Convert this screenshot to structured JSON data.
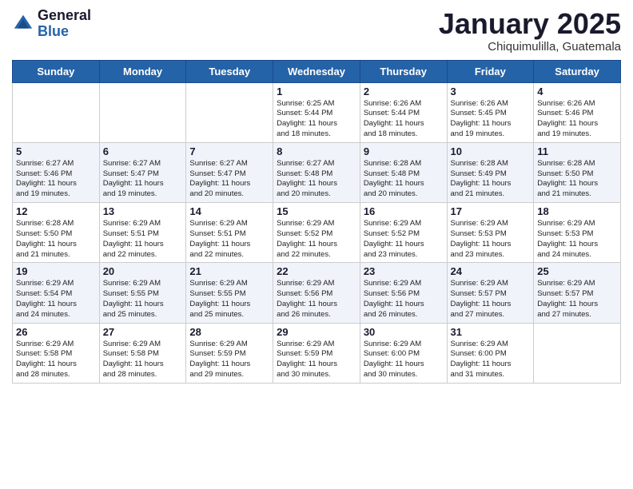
{
  "header": {
    "logo_general": "General",
    "logo_blue": "Blue",
    "title": "January 2025",
    "location": "Chiquimulilla, Guatemala"
  },
  "weekdays": [
    "Sunday",
    "Monday",
    "Tuesday",
    "Wednesday",
    "Thursday",
    "Friday",
    "Saturday"
  ],
  "weeks": [
    {
      "alt": false,
      "days": [
        {
          "num": "",
          "info": ""
        },
        {
          "num": "",
          "info": ""
        },
        {
          "num": "",
          "info": ""
        },
        {
          "num": "1",
          "info": "Sunrise: 6:25 AM\nSunset: 5:44 PM\nDaylight: 11 hours\nand 18 minutes."
        },
        {
          "num": "2",
          "info": "Sunrise: 6:26 AM\nSunset: 5:44 PM\nDaylight: 11 hours\nand 18 minutes."
        },
        {
          "num": "3",
          "info": "Sunrise: 6:26 AM\nSunset: 5:45 PM\nDaylight: 11 hours\nand 19 minutes."
        },
        {
          "num": "4",
          "info": "Sunrise: 6:26 AM\nSunset: 5:46 PM\nDaylight: 11 hours\nand 19 minutes."
        }
      ]
    },
    {
      "alt": true,
      "days": [
        {
          "num": "5",
          "info": "Sunrise: 6:27 AM\nSunset: 5:46 PM\nDaylight: 11 hours\nand 19 minutes."
        },
        {
          "num": "6",
          "info": "Sunrise: 6:27 AM\nSunset: 5:47 PM\nDaylight: 11 hours\nand 19 minutes."
        },
        {
          "num": "7",
          "info": "Sunrise: 6:27 AM\nSunset: 5:47 PM\nDaylight: 11 hours\nand 20 minutes."
        },
        {
          "num": "8",
          "info": "Sunrise: 6:27 AM\nSunset: 5:48 PM\nDaylight: 11 hours\nand 20 minutes."
        },
        {
          "num": "9",
          "info": "Sunrise: 6:28 AM\nSunset: 5:48 PM\nDaylight: 11 hours\nand 20 minutes."
        },
        {
          "num": "10",
          "info": "Sunrise: 6:28 AM\nSunset: 5:49 PM\nDaylight: 11 hours\nand 21 minutes."
        },
        {
          "num": "11",
          "info": "Sunrise: 6:28 AM\nSunset: 5:50 PM\nDaylight: 11 hours\nand 21 minutes."
        }
      ]
    },
    {
      "alt": false,
      "days": [
        {
          "num": "12",
          "info": "Sunrise: 6:28 AM\nSunset: 5:50 PM\nDaylight: 11 hours\nand 21 minutes."
        },
        {
          "num": "13",
          "info": "Sunrise: 6:29 AM\nSunset: 5:51 PM\nDaylight: 11 hours\nand 22 minutes."
        },
        {
          "num": "14",
          "info": "Sunrise: 6:29 AM\nSunset: 5:51 PM\nDaylight: 11 hours\nand 22 minutes."
        },
        {
          "num": "15",
          "info": "Sunrise: 6:29 AM\nSunset: 5:52 PM\nDaylight: 11 hours\nand 22 minutes."
        },
        {
          "num": "16",
          "info": "Sunrise: 6:29 AM\nSunset: 5:52 PM\nDaylight: 11 hours\nand 23 minutes."
        },
        {
          "num": "17",
          "info": "Sunrise: 6:29 AM\nSunset: 5:53 PM\nDaylight: 11 hours\nand 23 minutes."
        },
        {
          "num": "18",
          "info": "Sunrise: 6:29 AM\nSunset: 5:53 PM\nDaylight: 11 hours\nand 24 minutes."
        }
      ]
    },
    {
      "alt": true,
      "days": [
        {
          "num": "19",
          "info": "Sunrise: 6:29 AM\nSunset: 5:54 PM\nDaylight: 11 hours\nand 24 minutes."
        },
        {
          "num": "20",
          "info": "Sunrise: 6:29 AM\nSunset: 5:55 PM\nDaylight: 11 hours\nand 25 minutes."
        },
        {
          "num": "21",
          "info": "Sunrise: 6:29 AM\nSunset: 5:55 PM\nDaylight: 11 hours\nand 25 minutes."
        },
        {
          "num": "22",
          "info": "Sunrise: 6:29 AM\nSunset: 5:56 PM\nDaylight: 11 hours\nand 26 minutes."
        },
        {
          "num": "23",
          "info": "Sunrise: 6:29 AM\nSunset: 5:56 PM\nDaylight: 11 hours\nand 26 minutes."
        },
        {
          "num": "24",
          "info": "Sunrise: 6:29 AM\nSunset: 5:57 PM\nDaylight: 11 hours\nand 27 minutes."
        },
        {
          "num": "25",
          "info": "Sunrise: 6:29 AM\nSunset: 5:57 PM\nDaylight: 11 hours\nand 27 minutes."
        }
      ]
    },
    {
      "alt": false,
      "days": [
        {
          "num": "26",
          "info": "Sunrise: 6:29 AM\nSunset: 5:58 PM\nDaylight: 11 hours\nand 28 minutes."
        },
        {
          "num": "27",
          "info": "Sunrise: 6:29 AM\nSunset: 5:58 PM\nDaylight: 11 hours\nand 28 minutes."
        },
        {
          "num": "28",
          "info": "Sunrise: 6:29 AM\nSunset: 5:59 PM\nDaylight: 11 hours\nand 29 minutes."
        },
        {
          "num": "29",
          "info": "Sunrise: 6:29 AM\nSunset: 5:59 PM\nDaylight: 11 hours\nand 30 minutes."
        },
        {
          "num": "30",
          "info": "Sunrise: 6:29 AM\nSunset: 6:00 PM\nDaylight: 11 hours\nand 30 minutes."
        },
        {
          "num": "31",
          "info": "Sunrise: 6:29 AM\nSunset: 6:00 PM\nDaylight: 11 hours\nand 31 minutes."
        },
        {
          "num": "",
          "info": ""
        }
      ]
    }
  ]
}
